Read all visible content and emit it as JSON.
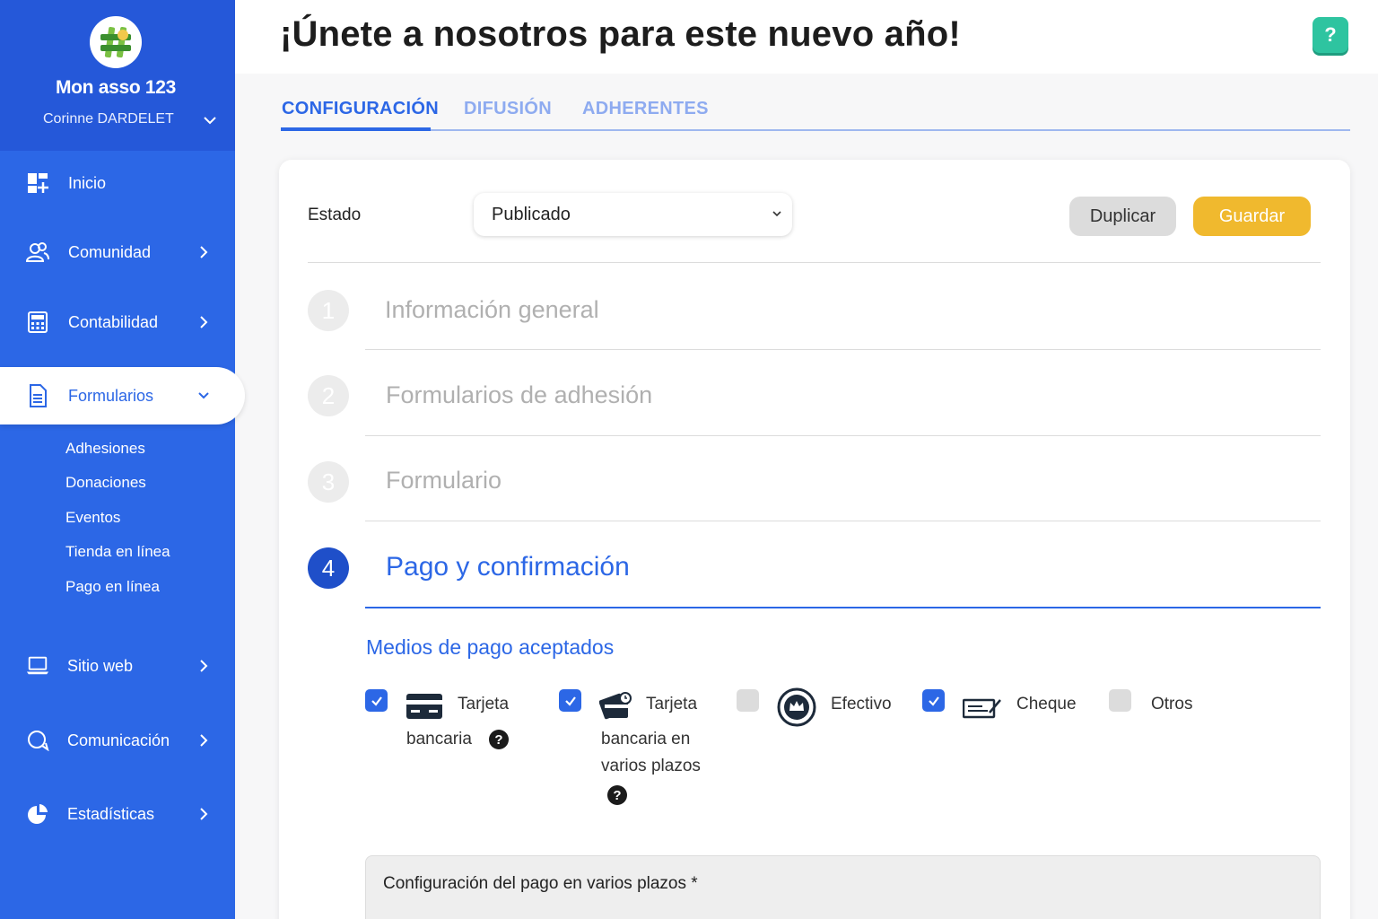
{
  "header": {
    "title": "¡Únete a nosotros para este nuevo año!",
    "help": "?"
  },
  "sidebar": {
    "org_name": "Mon asso 123",
    "user_name": "Corinne DARDELET",
    "items": [
      {
        "label": "Inicio",
        "icon": "dashboard-icon"
      },
      {
        "label": "Comunidad",
        "icon": "users-icon"
      },
      {
        "label": "Contabilidad",
        "icon": "calculator-icon"
      },
      {
        "label": "Formularios",
        "icon": "document-icon"
      },
      {
        "label": "Sitio web",
        "icon": "laptop-icon"
      },
      {
        "label": "Comunicación",
        "icon": "chat-icon"
      },
      {
        "label": "Estadísticas",
        "icon": "pie-chart-icon"
      }
    ],
    "sub_items": [
      "Adhesiones",
      "Donaciones",
      "Eventos",
      "Tienda en línea",
      "Pago en línea"
    ]
  },
  "tabs": [
    "CONFIGURACIÓN",
    "DIFUSIÓN",
    "ADHERENTES"
  ],
  "form": {
    "estado_label": "Estado",
    "estado_value": "Publicado",
    "duplicate_label": "Duplicar",
    "save_label": "Guardar"
  },
  "steps": [
    {
      "number": "1",
      "title": "Información general"
    },
    {
      "number": "2",
      "title": "Formularios de adhesión"
    },
    {
      "number": "3",
      "title": "Formulario"
    },
    {
      "number": "4",
      "title": "Pago y confirmación"
    }
  ],
  "payment": {
    "title": "Medios de pago aceptados",
    "methods": [
      {
        "line1": "Tarjeta",
        "line2": "bancaria",
        "line3": "",
        "checked": true
      },
      {
        "line1": "Tarjeta",
        "line2": "bancaria en",
        "line3": "varios plazos",
        "checked": true
      },
      {
        "line1": "Efectivo",
        "checked": false
      },
      {
        "line1": "Cheque",
        "checked": true
      },
      {
        "line1": "Otros",
        "checked": false
      }
    ],
    "config_title": "Configuración del pago en varios plazos *"
  },
  "colors": {
    "primary": "#2c67e6",
    "sidebar": "#2c67e6",
    "save": "#f0b92e",
    "help": "#2ec4a0"
  }
}
